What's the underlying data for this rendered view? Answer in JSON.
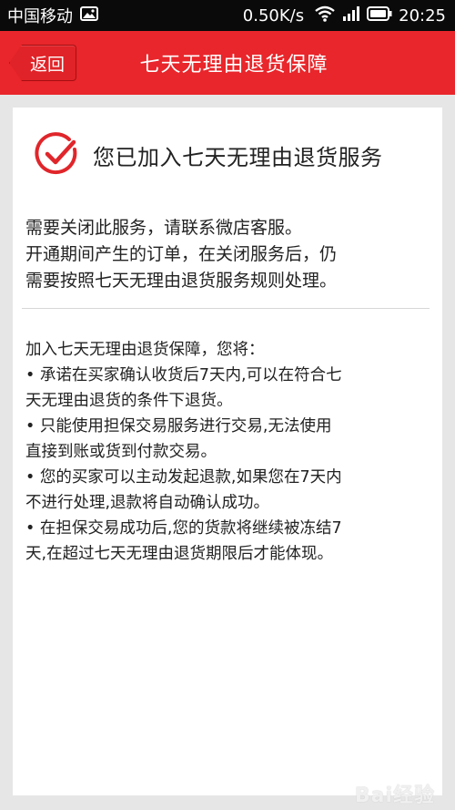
{
  "status_bar": {
    "carrier": "中国移动",
    "speed": "0.50K/s",
    "time": "20:25",
    "icons": [
      "image-icon",
      "wifi-icon",
      "signal-icon",
      "battery-icon"
    ]
  },
  "header": {
    "back_label": "返回",
    "title": "七天无理由退货保障",
    "color": "#e8262b"
  },
  "card": {
    "joined_text": "您已加入七天无理由退货服务",
    "check_icon_color": "#e0262b",
    "notice_lines": [
      "需要关闭此服务，请联系微店客服。",
      "开通期间产生的订单，在关闭服务后，仍",
      "需要按照七天无理由退货服务规则处理。"
    ],
    "terms_lines": [
      "加入七天无理由退货保障，您将：",
      "• 承诺在买家确认收货后7天内,可以在符合七",
      "天无理由退货的条件下退货。",
      "• 只能使用担保交易服务进行交易,无法使用",
      "直接到账或货到付款交易。",
      "• 您的买家可以主动发起退款,如果您在7天内",
      "不进行处理,退款将自动确认成功。",
      "• 在担保交易成功后,您的货款将继续被冻结7",
      "天,在超过七天无理由退货期限后才能体现。"
    ]
  },
  "watermark": "Bai经验"
}
